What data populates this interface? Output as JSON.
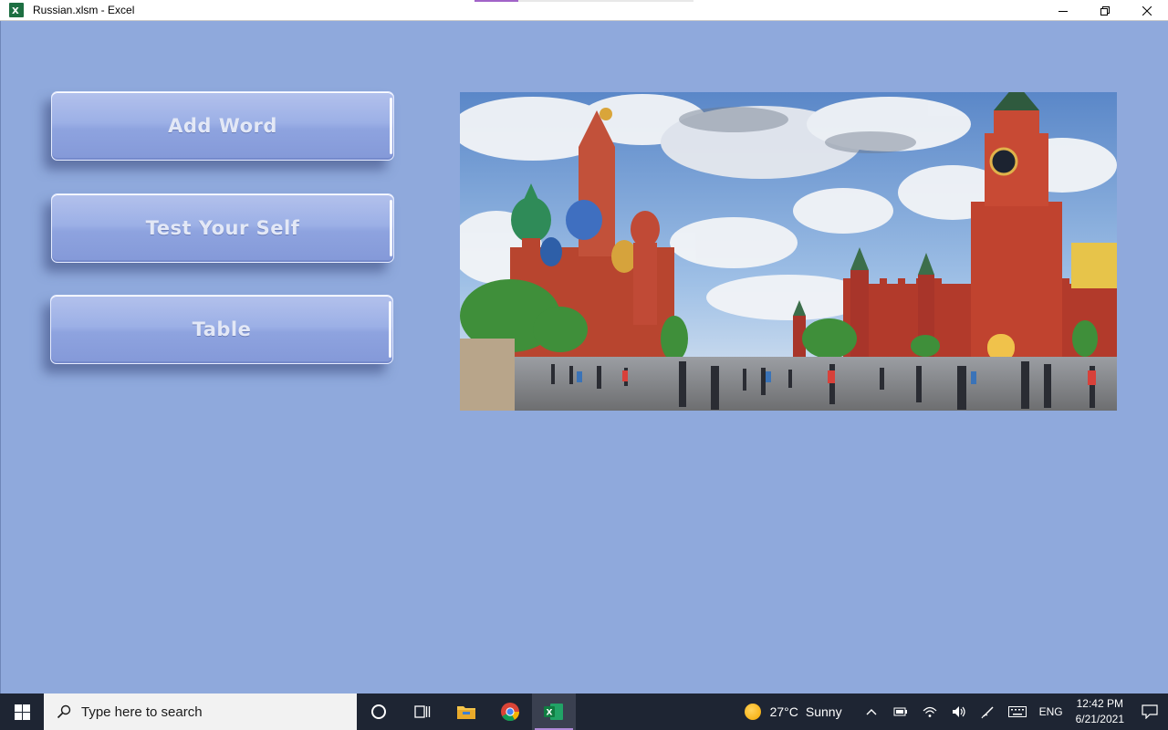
{
  "window": {
    "title": "Russian.xlsm - Excel",
    "app_icon": "excel-icon",
    "controls": [
      "minimize-icon",
      "restore-icon",
      "close-icon"
    ]
  },
  "buttons": [
    {
      "label": "Add Word"
    },
    {
      "label": "Test Your Self"
    },
    {
      "label": "Table"
    }
  ],
  "image": {
    "subject": "red-square-photo"
  },
  "taskbar": {
    "search_placeholder": "Type here to search",
    "pinned": [
      "cortana-icon",
      "task-view-icon",
      "file-explorer-icon",
      "chrome-icon",
      "excel-icon"
    ],
    "active": "excel-icon",
    "weather": {
      "temp": "27°C",
      "condition": "Sunny"
    },
    "language": "ENG",
    "time": "12:42 PM",
    "date": "6/21/2021"
  },
  "colors": {
    "workspace_bg": "#8fa9dc",
    "button_face": "#9cb0e6",
    "button_text": "#e3e8f6",
    "taskbar_bg": "#1e2533"
  }
}
